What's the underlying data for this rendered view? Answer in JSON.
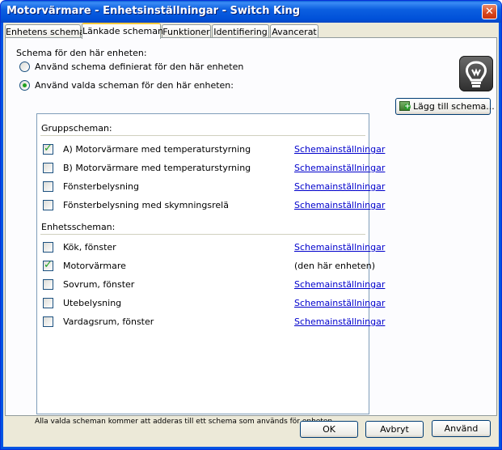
{
  "window": {
    "title": "Motorvärmare - Enhetsinställningar - Switch King",
    "close_glyph": "✕"
  },
  "tabs": [
    {
      "label": "Enhetens schema",
      "active": false
    },
    {
      "label": "Länkade scheman",
      "active": true
    },
    {
      "label": "Funktioner",
      "active": false
    },
    {
      "label": "Identifiering",
      "active": false
    },
    {
      "label": "Avancerat",
      "active": false
    }
  ],
  "schedule": {
    "heading": "Schema för den här enheten:",
    "option_device": "Använd schema definierat för den här enheten",
    "option_selected": "Använd valda scheman för den här enheten:",
    "selected_option": "option_selected"
  },
  "add_schedule_button": "Lägg till schema...",
  "app_icon": "lightbulb-icon",
  "list": {
    "group_heading": "Gruppscheman:",
    "groups": [
      {
        "label": "A) Motorvärmare med temperaturstyrning",
        "checked": true,
        "link": "Schemainställningar"
      },
      {
        "label": "B) Motorvärmare med temperaturstyrning",
        "checked": false,
        "link": "Schemainställningar"
      },
      {
        "label": "Fönsterbelysning",
        "checked": false,
        "link": "Schemainställningar"
      },
      {
        "label": "Fönsterbelysning med skymningsrelä",
        "checked": false,
        "link": "Schemainställningar"
      }
    ],
    "device_heading": "Enhetsscheman:",
    "devices": [
      {
        "label": "Kök, fönster",
        "checked": false,
        "link": "Schemainställningar"
      },
      {
        "label": "Motorvärmare",
        "checked": true,
        "link": "(den här enheten)"
      },
      {
        "label": "Sovrum, fönster",
        "checked": false,
        "link": "Schemainställningar"
      },
      {
        "label": "Utebelysning",
        "checked": false,
        "link": "Schemainställningar"
      },
      {
        "label": "Vardagsrum, fönster",
        "checked": false,
        "link": "Schemainställningar"
      }
    ]
  },
  "footnote": "Alla valda scheman kommer att adderas till ett schema som används för enheten.",
  "buttons": {
    "ok": "OK",
    "cancel": "Avbryt",
    "apply": "Använd"
  }
}
